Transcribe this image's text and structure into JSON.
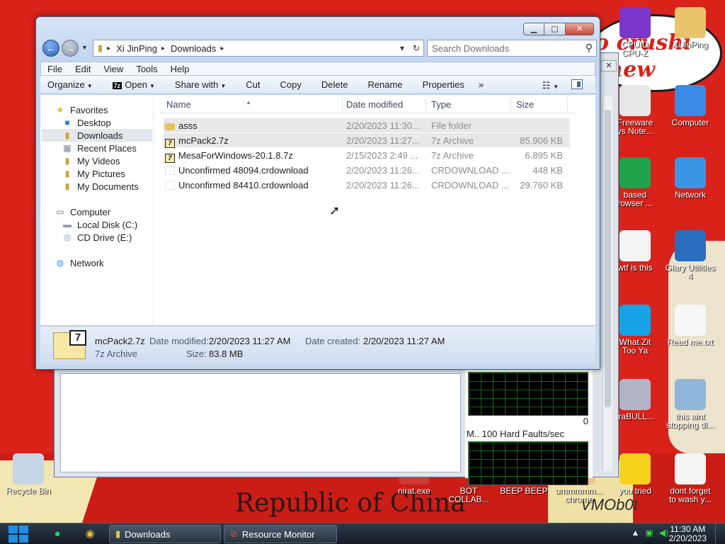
{
  "desktop": {
    "bubble_text": "o crushi\nchew",
    "slogan": "Republic of China",
    "watermark": "VMOb0t",
    "icons_right": [
      {
        "label": "CPUID\nCPU-Z",
        "icon": "cpuz-icon",
        "color": "#7a37c9"
      },
      {
        "label": "XiJinPing",
        "icon": "user-folder-icon",
        "color": "#e9c46a"
      },
      {
        "label": "Freeware\nys Note...",
        "icon": "document-icon",
        "color": "#e8e8e8"
      },
      {
        "label": "Computer",
        "icon": "computer-icon",
        "color": "#3a8be6"
      },
      {
        "label": "based\nrowser ...",
        "icon": "green-app-icon",
        "color": "#1fa34a"
      },
      {
        "label": "Network",
        "icon": "network-icon",
        "color": "#3b95e5"
      },
      {
        "label": "wtf is this",
        "icon": "calendar-icon",
        "color": "#f4f4f4"
      },
      {
        "label": "Glary Utilities\n4",
        "icon": "glary-icon",
        "color": "#2a6fbe"
      },
      {
        "label": "What Zit\nToo Ya",
        "icon": "skype-icon",
        "color": "#16a3e6"
      },
      {
        "label": "Read me.txt",
        "icon": "text-file-icon",
        "color": "#f7f7f7"
      },
      {
        "label": "traBULL...",
        "icon": "disc-icon",
        "color": "#b4b4c8"
      },
      {
        "label": "this aint\nstopping di...",
        "icon": "installer-icon",
        "color": "#8fb5db"
      },
      {
        "label": "you tried",
        "icon": "star-icon",
        "color": "#f6d21d"
      },
      {
        "label": "dont forget\nto wash y...",
        "icon": "calendar2-icon",
        "color": "#f4f4f4"
      }
    ],
    "icons_bottom": [
      {
        "label": "Recycle Bin",
        "icon": "recycle-bin-icon",
        "color": "#c7d6e6"
      },
      {
        "label": "nirat.exe",
        "icon": "exe-icon",
        "color": "#dcdcdc"
      },
      {
        "label": "BOT\nCOLLAB...",
        "icon": "bot-icon",
        "color": "#d8221a"
      },
      {
        "label": "BEEP BEEP",
        "icon": "beep-icon",
        "color": "#d8221a"
      },
      {
        "label": "ummmmm...\nchrome",
        "icon": "chrome-icon",
        "color": "#d8221a"
      }
    ]
  },
  "resmon": {
    "graph_zero": "0",
    "graph_label": "M.. 100 Hard Faults/sec"
  },
  "explorer": {
    "address": {
      "segments": [
        "Xi JinPing",
        "Downloads"
      ]
    },
    "search": {
      "placeholder": "Search Downloads"
    },
    "menu": [
      "File",
      "Edit",
      "View",
      "Tools",
      "Help"
    ],
    "commands": {
      "organize": "Organize",
      "open": "Open",
      "share": "Share with",
      "cut": "Cut",
      "copy": "Copy",
      "delete": "Delete",
      "rename": "Rename",
      "properties": "Properties",
      "more": "»"
    },
    "nav": {
      "favorites": "Favorites",
      "desktop": "Desktop",
      "downloads": "Downloads",
      "recent": "Recent Places",
      "videos": "My Videos",
      "pictures": "My Pictures",
      "documents": "My Documents",
      "computer": "Computer",
      "local_disk": "Local Disk (C:)",
      "cd_drive": "CD Drive (E:)",
      "network": "Network"
    },
    "columns": {
      "name": "Name",
      "date": "Date modified",
      "type": "Type",
      "size": "Size"
    },
    "files": [
      {
        "name": "asss",
        "date": "2/20/2023 11:30...",
        "type": "File folder",
        "size": "",
        "kind": "folder"
      },
      {
        "name": "mcPack2.7z",
        "date": "2/20/2023 11:27...",
        "type": "7z Archive",
        "size": "85.906 KB",
        "kind": "zip"
      },
      {
        "name": "MesaForWindows-20.1.8.7z",
        "date": "2/15/2023 2:49 ...",
        "type": "7z Archive",
        "size": "6.895 KB",
        "kind": "zip"
      },
      {
        "name": "Unconfirmed 48094.crdownload",
        "date": "2/20/2023 11:26...",
        "type": "CRDOWNLOAD ...",
        "size": "448 KB",
        "kind": "cr"
      },
      {
        "name": "Unconfirmed 84410.crdownload",
        "date": "2/20/2023 11:26...",
        "type": "CRDOWNLOAD ...",
        "size": "29.760 KB",
        "kind": "cr"
      }
    ],
    "details": {
      "name": "mcPack2.7z",
      "type": "7z Archive",
      "modified_label": "Date modified:",
      "modified_value": "2/20/2023 11:27 AM",
      "created_label": "Date created:",
      "created_value": "2/20/2023 11:27 AM",
      "size_label": "Size:",
      "size_value": "83.8 MB",
      "badge": "7"
    }
  },
  "taskbar": {
    "tasks": [
      "Downloads",
      "Resource Monitor"
    ],
    "time": "11:30 AM",
    "date": "2/20/2023"
  }
}
